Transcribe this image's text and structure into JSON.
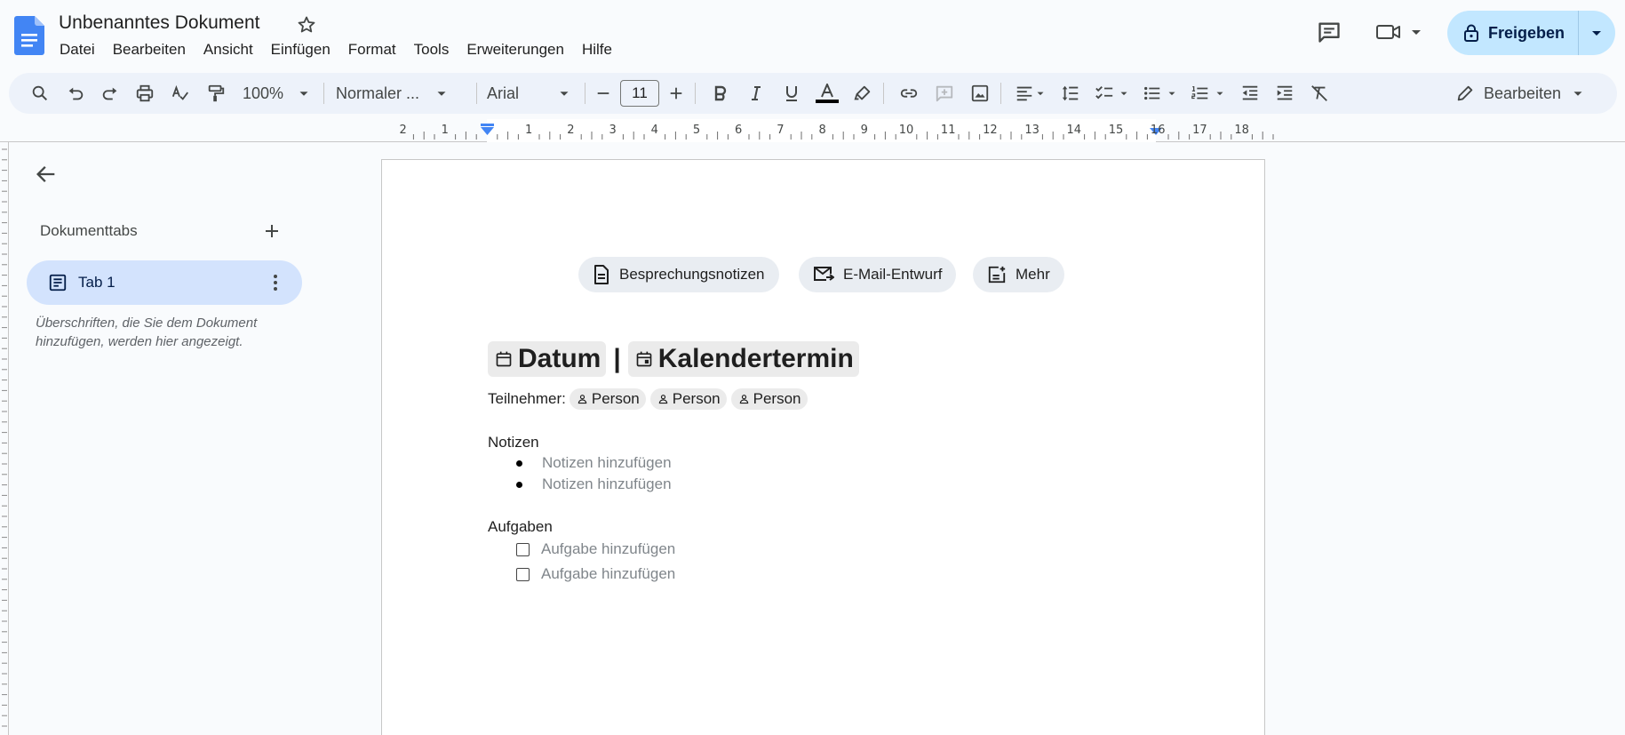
{
  "app": {
    "title": "Unbenanntes Dokument",
    "menu": [
      "Datei",
      "Bearbeiten",
      "Ansicht",
      "Einfügen",
      "Format",
      "Tools",
      "Erweiterungen",
      "Hilfe"
    ],
    "share_label": "Freigeben"
  },
  "toolbar": {
    "zoom": "100%",
    "style": "Normaler ...",
    "font": "Arial",
    "font_size": "11",
    "mode_label": "Bearbeiten"
  },
  "ruler": {
    "labels": [
      "2",
      "1",
      "1",
      "2",
      "3",
      "4",
      "5",
      "6",
      "7",
      "8",
      "9",
      "10",
      "11",
      "12",
      "13",
      "14",
      "15",
      "16",
      "17",
      "18"
    ]
  },
  "sidebar": {
    "heading": "Dokumenttabs",
    "tab_label": "Tab 1",
    "hint": "Überschriften, die Sie dem Dokument hinzufügen, werden hier angezeigt."
  },
  "document": {
    "chips": [
      "Besprechungsnotizen",
      "E-Mail-Entwurf",
      "Mehr"
    ],
    "heading_date": "Datum",
    "heading_separator": "|",
    "heading_event": "Kalendertermin",
    "attendees_label": "Teilnehmer:",
    "people": [
      "Person",
      "Person",
      "Person"
    ],
    "notes_title": "Notizen",
    "notes": [
      "Notizen hinzufügen",
      "Notizen hinzufügen"
    ],
    "tasks_title": "Aufgaben",
    "tasks": [
      "Aufgabe hinzufügen",
      "Aufgabe hinzufügen"
    ]
  },
  "colors": {
    "share_bg": "#c2e7ff",
    "toolbar_bg": "#edf2fa",
    "active_tab_bg": "#d3e3fd",
    "docs_blue": "#4285f4"
  }
}
